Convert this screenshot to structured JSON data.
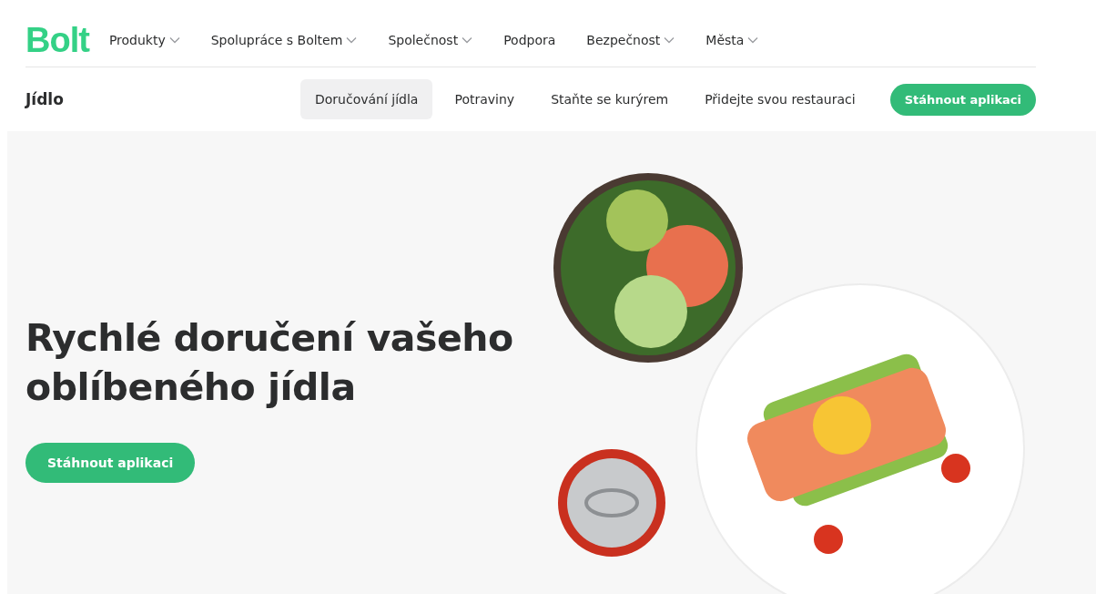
{
  "header": {
    "logo": "Bolt",
    "nav": [
      {
        "label": "Produkty",
        "dropdown": true
      },
      {
        "label": "Spolupráce s Boltem",
        "dropdown": true
      },
      {
        "label": "Společnost",
        "dropdown": true
      },
      {
        "label": "Podpora",
        "dropdown": false
      },
      {
        "label": "Bezpečnost",
        "dropdown": true
      },
      {
        "label": "Města",
        "dropdown": true
      }
    ]
  },
  "subnav": {
    "title": "Jídlo",
    "tabs": [
      {
        "label": "Doručování jídla",
        "selected": true
      },
      {
        "label": "Potraviny",
        "selected": false
      },
      {
        "label": "Staňte se kurýrem",
        "selected": false
      },
      {
        "label": "Přidejte svou restauraci",
        "selected": false
      }
    ],
    "button": "Stáhnout aplikaci"
  },
  "hero": {
    "heading_lines": [
      "Rychlé doručení vašeho",
      "oblíbeného jídla"
    ],
    "button": "Stáhnout aplikaci"
  }
}
